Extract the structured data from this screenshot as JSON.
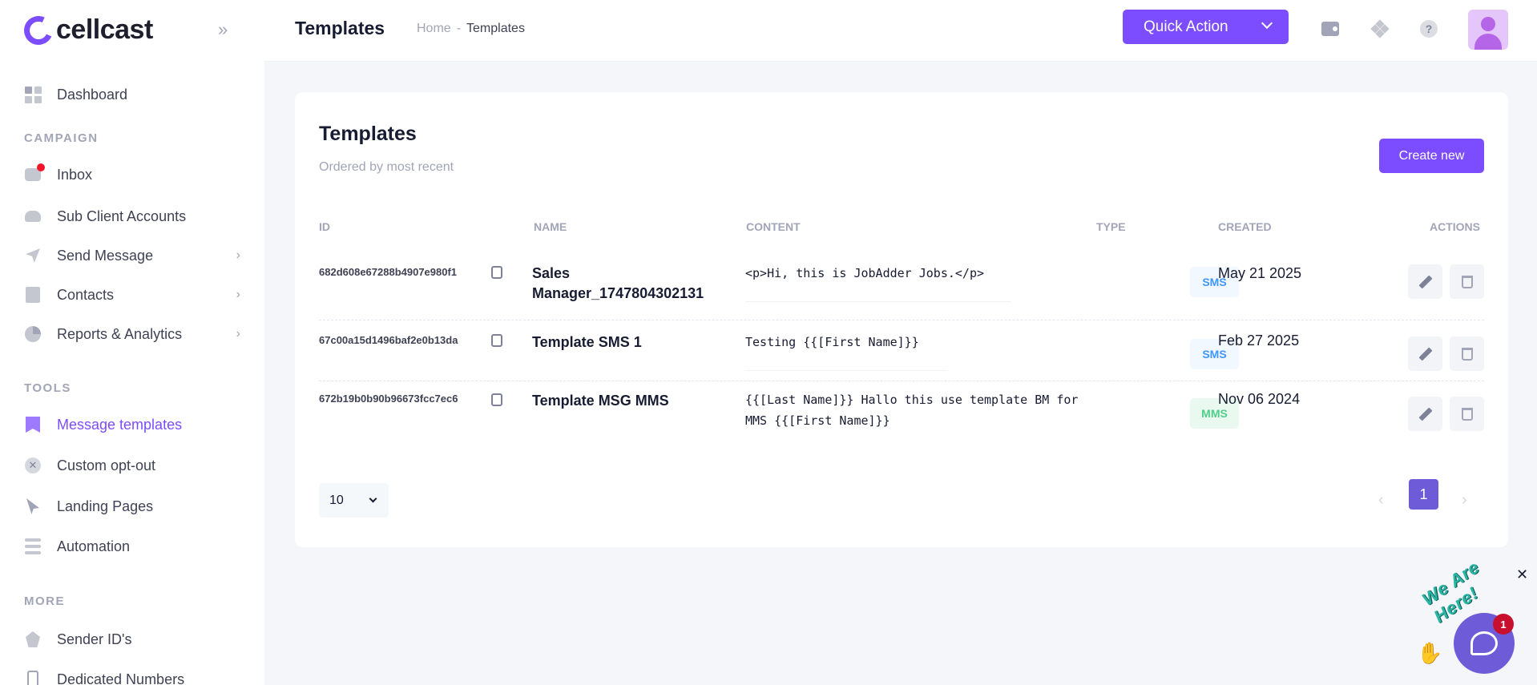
{
  "brand": {
    "name": "cellcast"
  },
  "sidebar": {
    "dashboard": "Dashboard",
    "sections": {
      "campaign": "CAMPAIGN",
      "tools": "TOOLS",
      "more": "MORE"
    },
    "campaign_items": [
      {
        "label": "Inbox",
        "icon": "inbox-icon"
      },
      {
        "label": "Sub Client Accounts",
        "icon": "users-icon"
      },
      {
        "label": "Send Message",
        "icon": "rocket-icon",
        "chevron": true
      },
      {
        "label": "Contacts",
        "icon": "contacts-icon",
        "chevron": true
      },
      {
        "label": "Reports & Analytics",
        "icon": "pie-chart-icon",
        "chevron": true
      }
    ],
    "tools_items": [
      {
        "label": "Message templates",
        "icon": "bookmark-icon",
        "active": true
      },
      {
        "label": "Custom opt-out",
        "icon": "x-circle-icon"
      },
      {
        "label": "Landing Pages",
        "icon": "cursor-icon"
      },
      {
        "label": "Automation",
        "icon": "flow-icon"
      }
    ],
    "more_items": [
      {
        "label": "Sender ID's",
        "icon": "badge-icon"
      },
      {
        "label": "Dedicated Numbers",
        "icon": "phone-icon"
      }
    ]
  },
  "header": {
    "title": "Templates",
    "breadcrumb": {
      "home": "Home",
      "separator": "-",
      "current": "Templates"
    },
    "quick_action": "Quick Action"
  },
  "card": {
    "title": "Templates",
    "subtitle": "Ordered by most recent",
    "create_button": "Create new",
    "columns": {
      "id": "ID",
      "name": "NAME",
      "content": "CONTENT",
      "type": "TYPE",
      "created": "CREATED",
      "actions": "ACTIONS"
    },
    "rows": [
      {
        "id": "682d608e67288b4907e980f1",
        "name": "Sales Manager_1747804302131",
        "content": "<p>Hi, this is JobAdder Jobs.</p>",
        "type": "SMS",
        "created": "May 21 2025"
      },
      {
        "id": "67c00a15d1496baf2e0b13da",
        "name": "Template SMS 1",
        "content": "Testing {{[First Name]}}",
        "type": "SMS",
        "created": "Feb 27 2025"
      },
      {
        "id": "672b19b0b90b96673fcc7ec6",
        "name": "Template MSG MMS",
        "content": "{{[Last Name]}} Hallo this use template BM for MMS {{[First Name]}}",
        "type": "MMS",
        "created": "Nov 06 2024"
      }
    ],
    "pagination": {
      "page_size": "10",
      "current_page": "1",
      "prev": "‹",
      "next": "›"
    }
  },
  "chat_widget": {
    "banner": "We Are Here!",
    "unread": "1",
    "close": "✕"
  },
  "colors": {
    "accent": "#7c4dff",
    "sms_badge": "#3e97ff",
    "mms_badge": "#50cd89",
    "notification": "#f1142a"
  }
}
